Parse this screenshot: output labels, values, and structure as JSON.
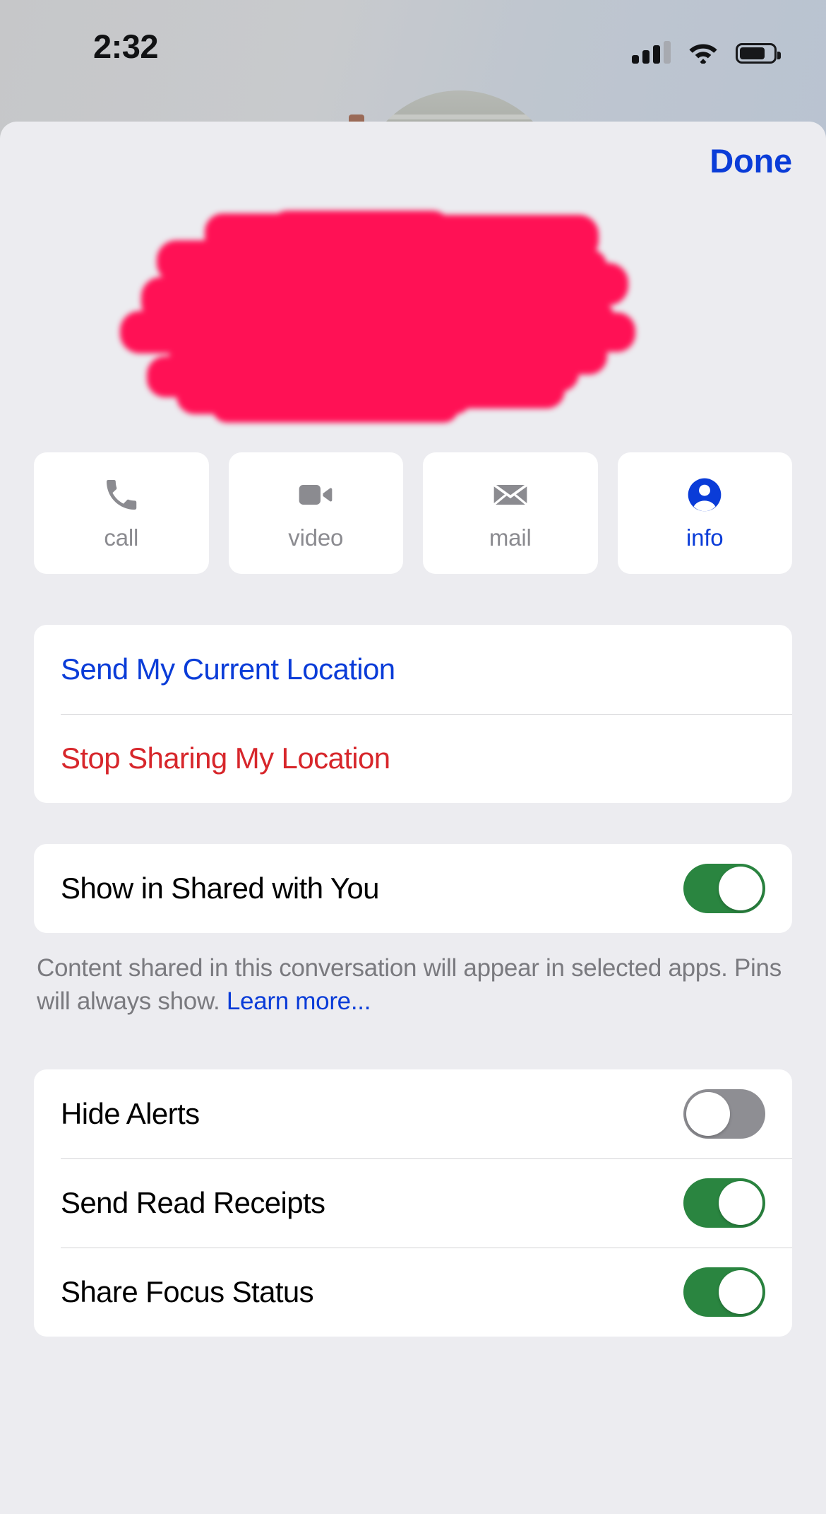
{
  "status_bar": {
    "time": "2:32",
    "cellular_icon": "cellular-signal-icon",
    "cellular_bars_filled": 3,
    "cellular_bars_total": 4,
    "wifi_icon": "wifi-icon",
    "battery_icon": "battery-icon",
    "battery_percent": 75
  },
  "header": {
    "done_label": "Done"
  },
  "contact": {
    "redacted": true,
    "redaction_color": "#FF1155",
    "redaction_note": "contact name redacted with pink marker scribble"
  },
  "actions": [
    {
      "label": "call",
      "icon": "phone-icon",
      "active": false
    },
    {
      "label": "video",
      "icon": "video-camera-icon",
      "active": false
    },
    {
      "label": "mail",
      "icon": "envelope-icon",
      "active": false
    },
    {
      "label": "info",
      "icon": "person-circle-icon",
      "active": true
    }
  ],
  "location_group": {
    "rows": [
      {
        "label": "Send My Current Location",
        "style": "blue"
      },
      {
        "label": "Stop Sharing My Location",
        "style": "red"
      }
    ]
  },
  "shared_with_you_group": {
    "rows": [
      {
        "label": "Show in Shared with You",
        "toggle": "on"
      }
    ],
    "footnote_text": "Content shared in this conversation will appear in selected apps. Pins will always show. ",
    "footnote_link": "Learn more..."
  },
  "settings_group": {
    "rows": [
      {
        "label": "Hide Alerts",
        "toggle": "off"
      },
      {
        "label": "Send Read Receipts",
        "toggle": "on"
      },
      {
        "label": "Share Focus Status",
        "toggle": "on"
      }
    ]
  },
  "colors": {
    "accent_blue": "#0A3CD8",
    "destructive_red": "#D7262B",
    "toggle_on_green": "#2A8540",
    "toggle_off_gray": "#8E8E93",
    "sheet_background": "#ECECF0",
    "card_background": "#FFFFFF",
    "secondary_text": "#8B8B90"
  }
}
